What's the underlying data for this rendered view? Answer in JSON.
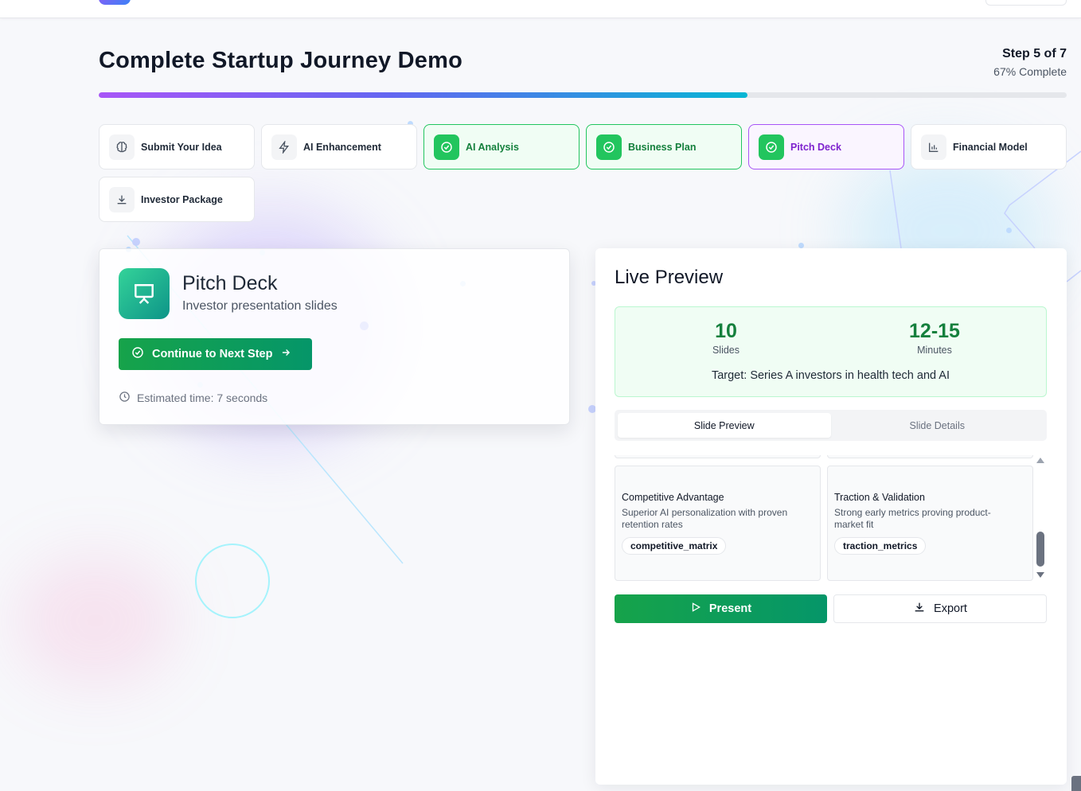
{
  "header": {
    "title": "Complete Startup Journey Demo",
    "step_label": "Step 5 of 7",
    "percent_label": "67% Complete",
    "progress": 0.67
  },
  "steps": [
    {
      "label": "Submit Your Idea",
      "icon": "brain-icon",
      "status": "pending"
    },
    {
      "label": "AI Enhancement",
      "icon": "lightning-icon",
      "status": "pending"
    },
    {
      "label": "AI Analysis",
      "icon": "check-circle-icon",
      "status": "done"
    },
    {
      "label": "Business Plan",
      "icon": "check-circle-icon",
      "status": "done"
    },
    {
      "label": "Pitch Deck",
      "icon": "check-circle-icon",
      "status": "active"
    },
    {
      "label": "Financial Model",
      "icon": "bar-chart-icon",
      "status": "pending"
    },
    {
      "label": "Investor Package",
      "icon": "download-icon",
      "status": "pending"
    }
  ],
  "current": {
    "title": "Pitch Deck",
    "subtitle": "Investor presentation slides",
    "icon": "presentation-icon",
    "continue_label": "Continue to Next Step",
    "estimate": "Estimated time: 7 seconds"
  },
  "preview": {
    "title": "Live Preview",
    "slides_count": "10",
    "slides_label": "Slides",
    "minutes_count": "12-15",
    "minutes_label": "Minutes",
    "target": "Target: Series A investors in health tech and AI",
    "tabs": [
      {
        "label": "Slide Preview",
        "selected": true
      },
      {
        "label": "Slide Details",
        "selected": false
      }
    ],
    "slides": [
      {
        "title": "Competitive Advantage",
        "description": "Superior AI personalization with proven retention rates",
        "tag": "competitive_matrix"
      },
      {
        "title": "Traction & Validation",
        "description": "Strong early metrics proving product-market fit",
        "tag": "traction_metrics"
      }
    ],
    "present_label": "Present",
    "export_label": "Export"
  },
  "colors": {
    "accent_green": "#16a34a",
    "accent_purple": "#a855f7",
    "progress_start": "#a855f7",
    "progress_end": "#06b6d4"
  }
}
